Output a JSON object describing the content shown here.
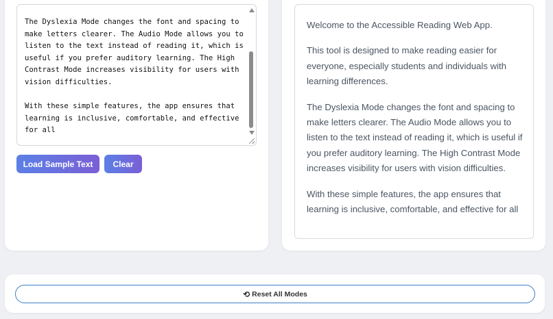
{
  "input_panel": {
    "text": "The Dyslexia Mode changes the font and spacing to make letters clearer. The Audio Mode allows you to listen to the text instead of reading it, which is useful if you prefer auditory learning. The High Contrast Mode increases visibility for users with vision difficulties.\n\nWith these simple features, the app ensures that learning is inclusive, comfortable, and effective for all",
    "load_sample_label": "Load Sample Text",
    "clear_label": "Clear"
  },
  "output_panel": {
    "paragraphs": [
      "Welcome to the Accessible Reading Web App.",
      "This tool is designed to make reading easier for everyone, especially students and individuals with learning differences.",
      "The Dyslexia Mode changes the font and spacing to make letters clearer. The Audio Mode allows you to listen to the text instead of reading it, which is useful if you prefer auditory learning. The High Contrast Mode increases visibility for users with vision difficulties.",
      "With these simple features, the app ensures that learning is inclusive, comfortable, and effective for all"
    ]
  },
  "footer": {
    "reset_icon": "refresh-icon",
    "reset_label": "Reset All Modes"
  },
  "colors": {
    "button_gradient_start": "#5b80e6",
    "button_gradient_end": "#7a5fd6",
    "reset_border": "#3b7ec5",
    "page_background": "#eef0f3"
  }
}
